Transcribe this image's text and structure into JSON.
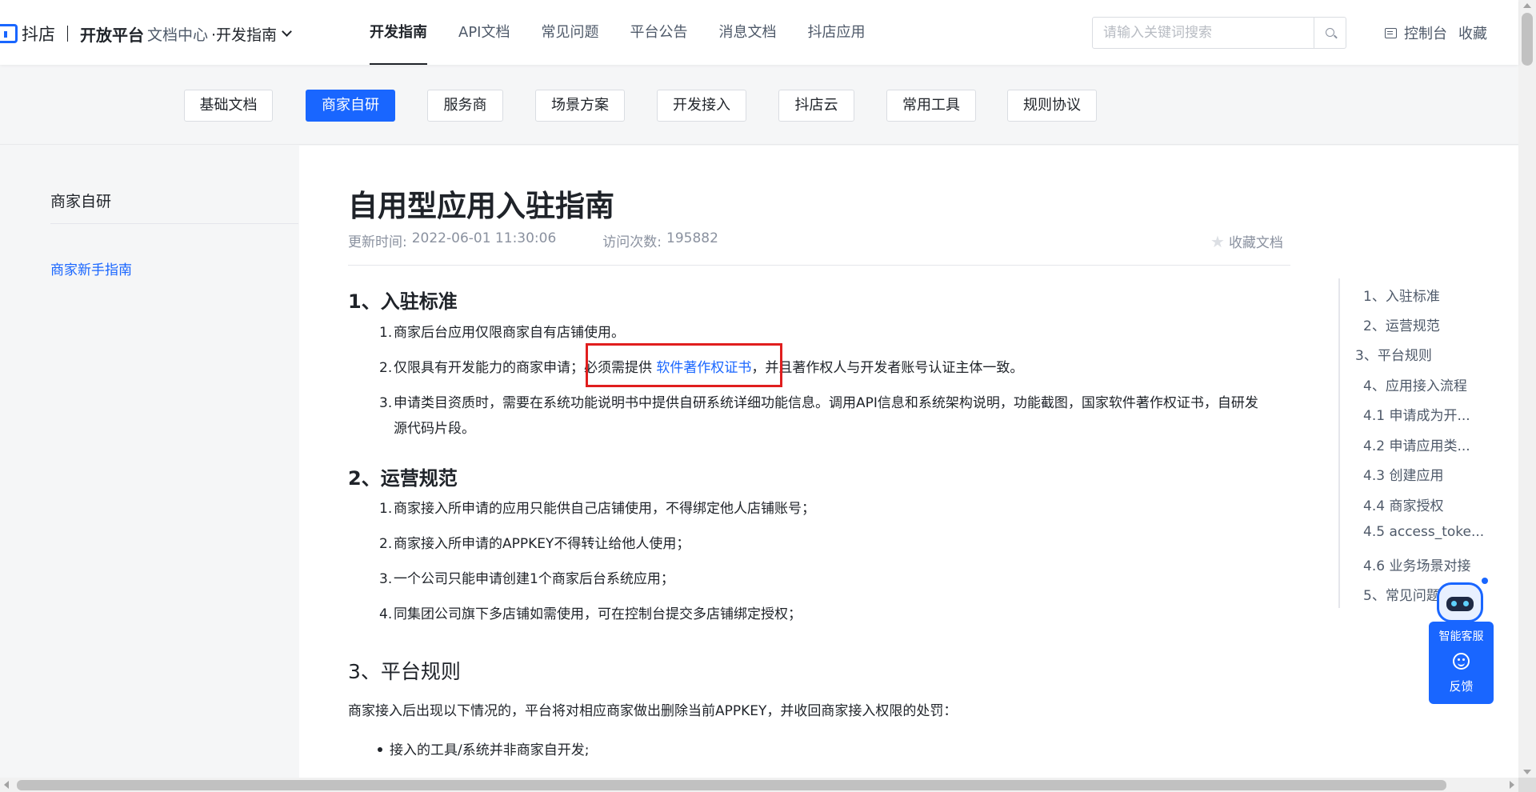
{
  "header": {
    "brand_name": "抖店",
    "platform": "开放平台",
    "doc_center": "文档中心",
    "guide_dropdown": "·开发指南",
    "nav": [
      "开发指南",
      "API文档",
      "常见问题",
      "平台公告",
      "消息文档",
      "抖店应用"
    ],
    "active_nav": "开发指南",
    "search_placeholder": "请输入关键词搜索",
    "console_label": "控制台",
    "favorite_label": "收藏"
  },
  "categories": [
    "基础文档",
    "商家自研",
    "服务商",
    "场景方案",
    "开发接入",
    "抖店云",
    "常用工具",
    "规则协议"
  ],
  "active_category": "商家自研",
  "sidebar": {
    "title": "商家自研",
    "items": [
      "商家新手指南"
    ]
  },
  "doc": {
    "title": "自用型应用入驻指南",
    "update_label": "更新时间:",
    "update_time": "2022-06-01 11:30:06",
    "visits_label": "访问次数:",
    "visits": "195882",
    "favorite_doc": "收藏文档",
    "section1": {
      "heading": "1、入驻标准",
      "items": [
        {
          "num": "1.",
          "text": "商家后台应用仅限商家自有店铺使用。"
        },
        {
          "num": "2.",
          "text_before": "仅限具有开发能力的商家申请；必须需提供 ",
          "link": "软件著作权证书",
          "text_after": "，并且著作权人与开发者账号认证主体一致。"
        },
        {
          "num": "3.",
          "text": "申请类目资质时，需要在系统功能说明书中提供自研系统详细功能信息。调用API信息和系统架构说明，功能截图，国家软件著作权证书，自研发",
          "text_cont": "源代码片段。"
        }
      ]
    },
    "section2": {
      "heading": "2、运营规范",
      "items": [
        {
          "num": "1.",
          "text": "商家接入所申请的应用只能供自己店铺使用，不得绑定他人店铺账号；"
        },
        {
          "num": "2.",
          "text": "商家接入所申请的APPKEY不得转让给他人使用；"
        },
        {
          "num": "3.",
          "text": "一个公司只能申请创建1个商家后台系统应用；"
        },
        {
          "num": "4.",
          "text": "同集团公司旗下多店铺如需使用，可在控制台提交多店铺绑定授权；"
        }
      ]
    },
    "section3": {
      "heading": "3、平台规则",
      "intro": "商家接入后出现以下情况的，平台将对相应商家做出删除当前APPKEY，并收回商家接入权限的处罚：",
      "bullets": [
        "接入的工具/系统并非商家自开发;"
      ]
    }
  },
  "toc": [
    "1、入驻标准",
    "2、运营规范",
    "3、平台规则",
    "4、应用接入流程",
    "4.1 申请成为开...",
    "4.2 申请应用类...",
    "4.3 创建应用",
    "4.4 商家授权",
    "4.5 access_toke...",
    "4.6 业务场景对接",
    "5、常见问题"
  ],
  "assistant": {
    "label": "智能客服",
    "feedback": "反馈"
  },
  "colors": {
    "accent": "#1966ff",
    "highlight_box": "#e01e1e"
  }
}
